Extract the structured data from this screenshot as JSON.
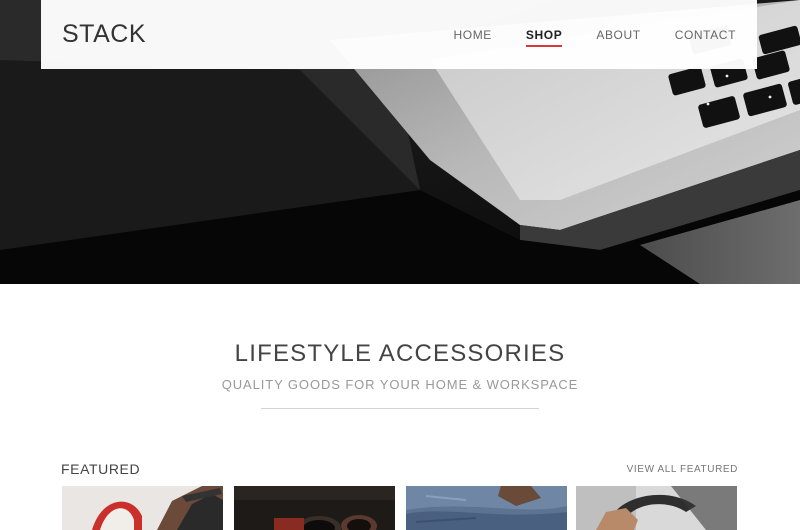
{
  "nav": {
    "logo": "STACK",
    "items": [
      {
        "label": "HOME",
        "active": false
      },
      {
        "label": "SHOP",
        "active": true
      },
      {
        "label": "ABOUT",
        "active": false
      },
      {
        "label": "CONTACT",
        "active": false
      }
    ],
    "accent_color": "#d63a3a"
  },
  "hero": {
    "image": "laptop-keyboard-photo"
  },
  "section": {
    "title": "LIFESTYLE ACCESSORIES",
    "subtitle": "QUALITY GOODS FOR YOUR HOME & WORKSPACE"
  },
  "featured": {
    "label": "FEATURED",
    "view_all": "VIEW ALL FEATURED",
    "products": [
      {
        "image": "product-photo-1"
      },
      {
        "image": "product-photo-2"
      },
      {
        "image": "product-photo-3"
      },
      {
        "image": "product-photo-4"
      }
    ]
  }
}
